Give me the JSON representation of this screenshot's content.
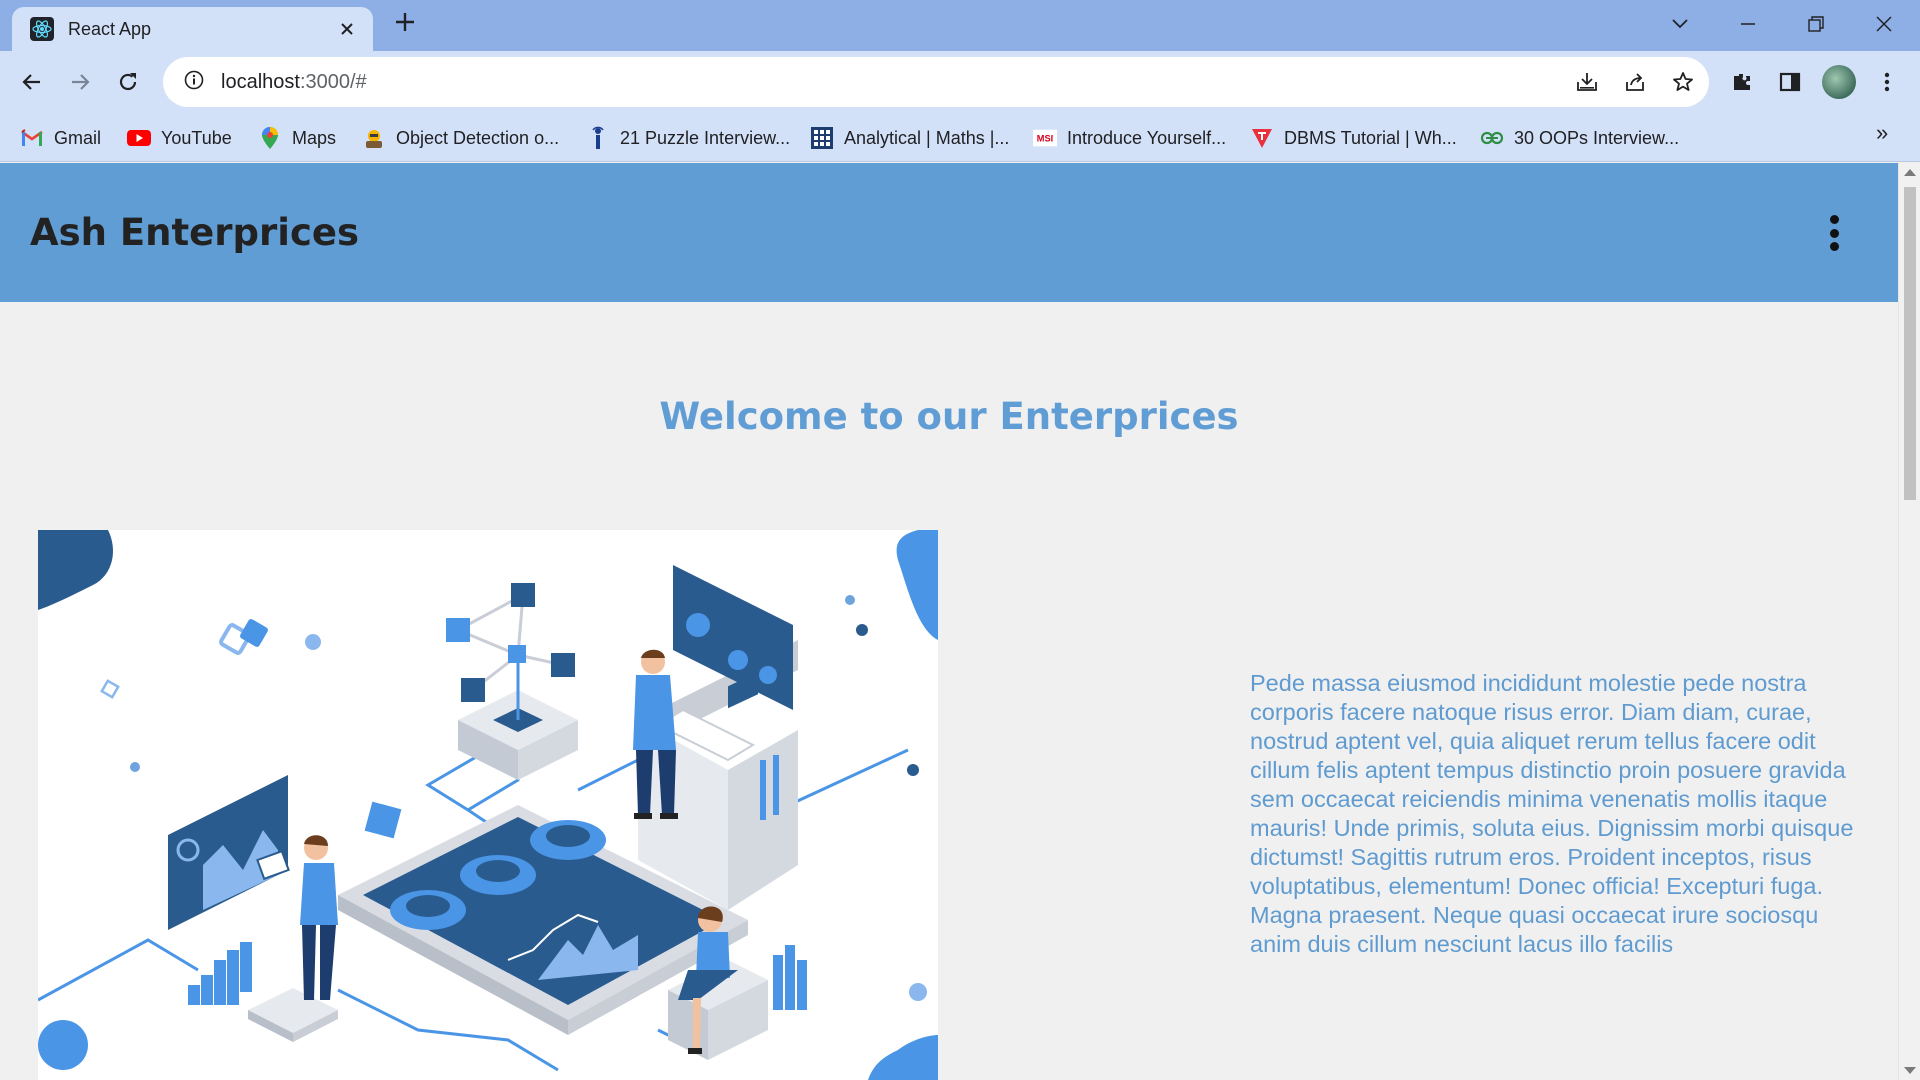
{
  "browser": {
    "tab": {
      "title": "React App",
      "favicon": "react-icon"
    },
    "new_tab_label": "+",
    "url": {
      "host": "localhost",
      "rest": ":3000/#"
    },
    "bookmarks": [
      {
        "label": "Gmail",
        "icon": "gmail-icon"
      },
      {
        "label": "YouTube",
        "icon": "youtube-icon"
      },
      {
        "label": "Maps",
        "icon": "maps-icon"
      },
      {
        "label": "Object Detection o...",
        "icon": "object-detection-icon"
      },
      {
        "label": "21 Puzzle Interview...",
        "icon": "puzzle-icon"
      },
      {
        "label": "Analytical | Maths |...",
        "icon": "grid-icon"
      },
      {
        "label": "Introduce Yourself...",
        "icon": "msi-icon"
      },
      {
        "label": "DBMS Tutorial | Wh...",
        "icon": "dbms-icon"
      },
      {
        "label": "30 OOPs Interview...",
        "icon": "gfg-icon"
      }
    ],
    "bookmarks_overflow": "»"
  },
  "site": {
    "brand": "Ash Enterprices",
    "welcome": "Welcome to our Enterprices",
    "paragraph": "Pede massa eiusmod incididunt molestie pede nostra corporis facere natoque risus error. Diam diam, curae, nostrud aptent vel, quia aliquet rerum tellus facere odit cillum felis aptent tempus distinctio proin posuere gravida sem occaecat reiciendis minima venenatis mollis itaque mauris! Unde primis, soluta eius. Dignissim morbi quisque dictumst! Sagittis rutrum eros. Proident inceptos, risus voluptatibus, elementum! Donec officia! Excepturi fuga. Magna praesent. Neque quasi occaecat irure sociosqu anim duis cillum nesciunt lacus illo facilis"
  },
  "colors": {
    "header": "#619dd5",
    "accent": "#619dd5",
    "paragraph": "#5f9bd0",
    "illustration_dark": "#2a5b8f",
    "illustration_light": "#4a95e6"
  }
}
